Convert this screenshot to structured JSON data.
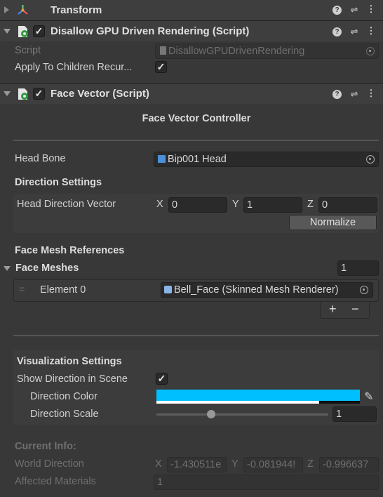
{
  "transform": {
    "title": "Transform"
  },
  "disallow": {
    "title": "Disallow GPU Driven Rendering (Script)",
    "script_label": "Script",
    "script_value": "DisallowGPUDrivenRendering",
    "apply_label": "Apply To Children Recur...",
    "apply_checked": "✓"
  },
  "face_vector": {
    "title": "Face Vector (Script)",
    "enabled_check": "✓",
    "controller_title": "Face Vector Controller",
    "head_bone_label": "Head Bone",
    "head_bone_value": "Bip001 Head",
    "direction_settings": "Direction Settings",
    "head_direction_label": "Head Direction Vector",
    "vec": {
      "x_label": "X",
      "x": "0",
      "y_label": "Y",
      "y": "1",
      "z_label": "Z",
      "z": "0"
    },
    "normalize_button": "Normalize",
    "face_mesh_refs": "Face Mesh References",
    "face_meshes_label": "Face Meshes",
    "face_meshes_count": "1",
    "element0_label": "Element 0",
    "element0_value": "Bell_Face (Skinned Mesh Renderer)",
    "plus": "+",
    "minus": "−",
    "visualization": "Visualization Settings",
    "show_direction_label": "Show Direction in Scene",
    "show_direction_checked": "✓",
    "direction_color_label": "Direction Color",
    "direction_color_value": "#00BFFF",
    "direction_scale_label": "Direction Scale",
    "direction_scale_value": "1",
    "direction_scale_fraction": 0.32,
    "current_info": "Current Info:",
    "world_direction_label": "World Direction",
    "world": {
      "x_label": "X",
      "x": "-1.430511e",
      "y_label": "Y",
      "y": "-0.081944!",
      "z_label": "Z",
      "z": "-0.996637"
    },
    "affected_label": "Affected Materials",
    "affected_value": "1"
  },
  "icons": {
    "help": "?",
    "presets": "⇌",
    "more": "⋮",
    "eyedropper": "✎",
    "list_handle": "="
  }
}
